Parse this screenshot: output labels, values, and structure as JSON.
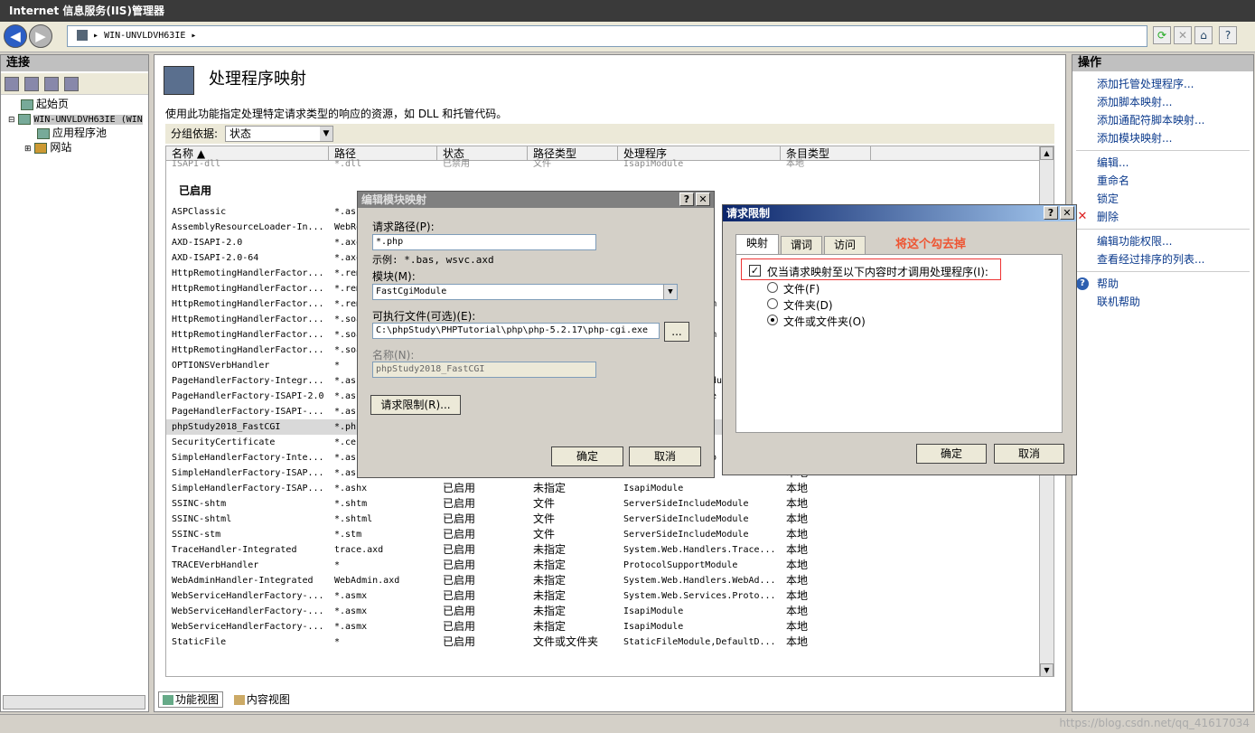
{
  "window": {
    "title": "Internet 信息服务(IIS)管理器"
  },
  "nav": {
    "back": "◀",
    "forward": "▶",
    "address": "WIN-UNVLDVH63IE",
    "address_sep": "▸"
  },
  "toolbar_icons": [
    "refresh-icon",
    "stop-icon",
    "home-icon",
    "help-icon"
  ],
  "connections": {
    "title": "连接",
    "tree": [
      {
        "label": "起始页"
      },
      {
        "label": "WIN-UNVLDVH63IE (WIN"
      },
      {
        "label": "应用程序池"
      },
      {
        "label": "网站"
      }
    ]
  },
  "main": {
    "title": "处理程序映射",
    "description": "使用此功能指定处理特定请求类型的响应的资源，如 DLL 和托管代码。",
    "group_label": "分组依据:",
    "group_value": "状态",
    "columns": [
      "名称 ▲",
      "路径",
      "状态",
      "路径类型",
      "处理程序",
      "条目类型"
    ],
    "ghost_row": [
      "ISAPI-dll",
      "*.dll",
      "已禁用",
      "文件",
      "IsapiModule",
      "本地"
    ],
    "section": "已启用",
    "rows": [
      [
        "ASPClassic",
        "*.asp",
        "",
        "",
        "",
        ""
      ],
      [
        "AssemblyResourceLoader-In...",
        "WebRe",
        "",
        "",
        "",
        ""
      ],
      [
        "AXD-ISAPI-2.0",
        "*.axd",
        "",
        "",
        "",
        ""
      ],
      [
        "AXD-ISAPI-2.0-64",
        "*.axd",
        "",
        "",
        "",
        ""
      ],
      [
        "HttpRemotingHandlerFactor...",
        "*.rem",
        "",
        "",
        "",
        ""
      ],
      [
        "HttpRemotingHandlerFactor...",
        "*.rem",
        "",
        "",
        "",
        ""
      ],
      [
        "HttpRemotingHandlerFactor...",
        "*.rem",
        "",
        "",
        "",
        ""
      ],
      [
        "HttpRemotingHandlerFactor...",
        "*.soap",
        "",
        "",
        "",
        ""
      ],
      [
        "HttpRemotingHandlerFactor...",
        "*.soap",
        "",
        "",
        "",
        ""
      ],
      [
        "HttpRemotingHandlerFactor...",
        "*.soap",
        "",
        "",
        "",
        ""
      ],
      [
        "OPTIONSVerbHandler",
        "*",
        "",
        "",
        "",
        ""
      ],
      [
        "PageHandlerFactory-Integr...",
        "*.aspx",
        "",
        "",
        "",
        ""
      ],
      [
        "PageHandlerFactory-ISAPI-2.0",
        "*.aspx",
        "",
        "",
        "",
        ""
      ],
      [
        "PageHandlerFactory-ISAPI-...",
        "*.aspx",
        "",
        "",
        "",
        ""
      ],
      [
        "phpStudy2018_FastCGI",
        "*.php",
        "",
        "",
        "",
        ""
      ],
      [
        "SecurityCertificate",
        "*.cer",
        "",
        "",
        "",
        ""
      ],
      [
        "SimpleHandlerFactory-Inte...",
        "*.ashx",
        "",
        "",
        "",
        ""
      ],
      [
        "SimpleHandlerFactory-ISAP...",
        "*.ashx",
        "",
        "",
        "",
        "本地"
      ],
      [
        "SimpleHandlerFactory-ISAP...",
        "*.ashx",
        "已启用",
        "未指定",
        "IsapiModule",
        "本地"
      ],
      [
        "SSINC-shtm",
        "*.shtm",
        "已启用",
        "文件",
        "ServerSideIncludeModule",
        "本地"
      ],
      [
        "SSINC-shtml",
        "*.shtml",
        "已启用",
        "文件",
        "ServerSideIncludeModule",
        "本地"
      ],
      [
        "SSINC-stm",
        "*.stm",
        "已启用",
        "文件",
        "ServerSideIncludeModule",
        "本地"
      ],
      [
        "TraceHandler-Integrated",
        "trace.axd",
        "已启用",
        "未指定",
        "System.Web.Handlers.Trace...",
        "本地"
      ],
      [
        "TRACEVerbHandler",
        "*",
        "已启用",
        "未指定",
        "ProtocolSupportModule",
        "本地"
      ],
      [
        "WebAdminHandler-Integrated",
        "WebAdmin.axd",
        "已启用",
        "未指定",
        "System.Web.Handlers.WebAd...",
        "本地"
      ],
      [
        "WebServiceHandlerFactory-...",
        "*.asmx",
        "已启用",
        "未指定",
        "System.Web.Services.Proto...",
        "本地"
      ],
      [
        "WebServiceHandlerFactory-...",
        "*.asmx",
        "已启用",
        "未指定",
        "IsapiModule",
        "本地"
      ],
      [
        "WebServiceHandlerFactory-...",
        "*.asmx",
        "已启用",
        "未指定",
        "IsapiModule",
        "本地"
      ],
      [
        "StaticFile",
        "*",
        "已启用",
        "文件或文件夹",
        "StaticFileModule,DefaultD...",
        "本地"
      ]
    ],
    "row_partial_right": [
      "",
      "",
      "",
      "",
      "",
      "",
      "m",
      "",
      "m",
      "",
      "",
      "dule",
      "e",
      "",
      "",
      "",
      "p",
      "",
      "",
      "",
      "",
      "",
      "",
      "",
      "",
      "",
      "",
      "",
      ""
    ]
  },
  "bottom_tabs": {
    "features": "功能视图",
    "content": "内容视图"
  },
  "actions": {
    "title": "操作",
    "items": [
      "添加托管处理程序...",
      "添加脚本映射...",
      "添加通配符脚本映射...",
      "添加模块映射...",
      "编辑...",
      "重命名",
      "锁定",
      "删除",
      "编辑功能权限...",
      "查看经过排序的列表...",
      "帮助",
      "联机帮助"
    ]
  },
  "edit_dialog": {
    "title": "编辑模块映射",
    "help": "?",
    "close": "✕",
    "path_label": "请求路径(P):",
    "path_value": "*.php",
    "example": "示例: *.bas, wsvc.axd",
    "module_label": "模块(M):",
    "module_value": "FastCgiModule",
    "exe_label": "可执行文件(可选)(E):",
    "exe_value": "C:\\phpStudy\\PHPTutorial\\php\\php-5.2.17\\php-cgi.exe",
    "browse": "...",
    "name_label": "名称(N):",
    "name_value": "phpStudy2018_FastCGI",
    "restrict_btn": "请求限制(R)...",
    "ok": "确定",
    "cancel": "取消"
  },
  "restrict_dialog": {
    "title": "请求限制",
    "help": "?",
    "close": "✕",
    "tabs": [
      "映射",
      "谓词",
      "访问"
    ],
    "annotation": "将这个勾去掉",
    "check_label": "仅当请求映射至以下内容时才调用处理程序(I):",
    "check_mark": "✓",
    "options": [
      "文件(F)",
      "文件夹(D)",
      "文件或文件夹(O)"
    ],
    "selected": 2,
    "ok": "确定",
    "cancel": "取消"
  },
  "status": {
    "watermark": "https://blog.csdn.net/qq_41617034"
  },
  "colors": {
    "dialog_title_active": "#0a246a",
    "dialog_title_inactive": "#808080",
    "link": "#0b3a8c",
    "annotation": "#e53935"
  }
}
